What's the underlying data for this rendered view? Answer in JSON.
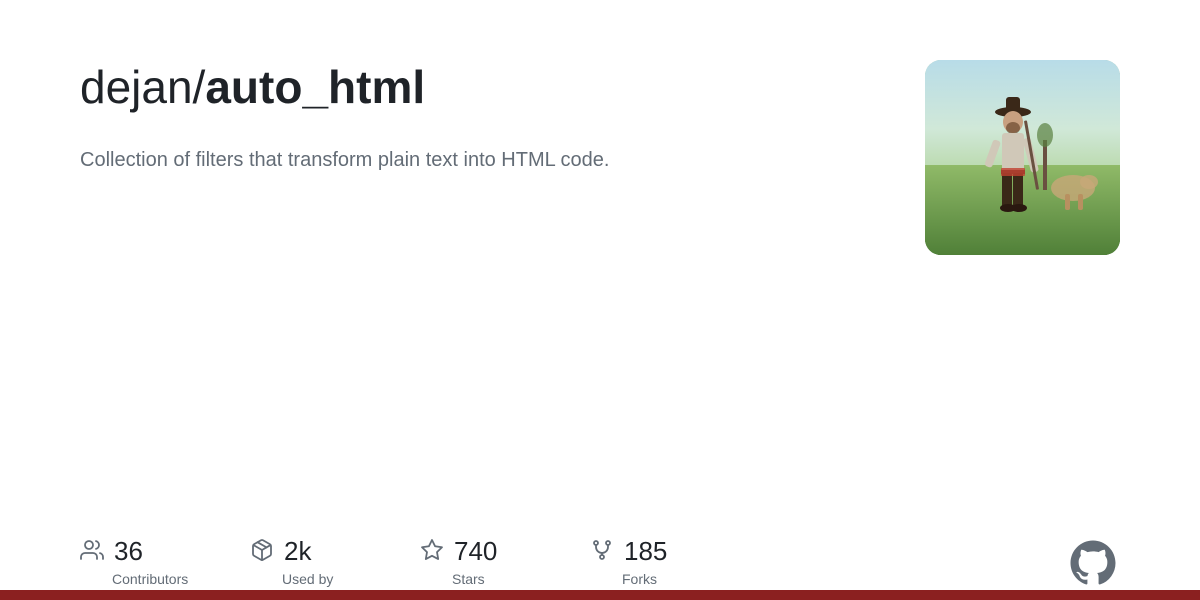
{
  "header": {
    "owner": "dejan/",
    "repo": "auto_html",
    "description": "Collection of filters that transform plain text into HTML code."
  },
  "stats": [
    {
      "id": "contributors",
      "number": "36",
      "label": "Contributors",
      "icon": "people-icon"
    },
    {
      "id": "used-by",
      "number": "2k",
      "label": "Used by",
      "icon": "package-icon"
    },
    {
      "id": "stars",
      "number": "740",
      "label": "Stars",
      "icon": "star-icon"
    },
    {
      "id": "forks",
      "number": "185",
      "label": "Forks",
      "icon": "fork-icon"
    }
  ],
  "bottom_bar": {
    "color": "#8b2020"
  }
}
